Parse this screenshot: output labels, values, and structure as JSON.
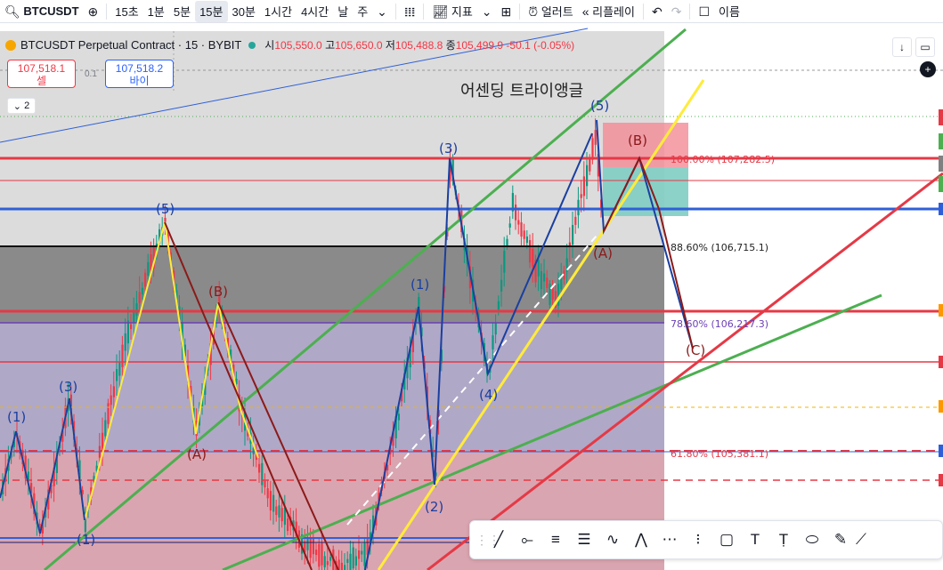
{
  "toolbar": {
    "symbol": "BTCUSDT",
    "intervals": [
      "15초",
      "1분",
      "5분",
      "15분",
      "30분",
      "1시간",
      "4시간",
      "날",
      "주"
    ],
    "active_interval": "15분",
    "indicators": "지표",
    "alert": "얼러트",
    "replay": "리플레이",
    "truncated_right": "이름"
  },
  "legend": {
    "title": "BTCUSDT Perpetual Contract · 15 · BYBIT",
    "open_label": "시",
    "open": "105,550.0",
    "high_label": "고",
    "high": "105,650.0",
    "low_label": "저",
    "low": "105,488.8",
    "close_label": "종",
    "close": "105,499.9",
    "change": "-50.1 (-0.05%)"
  },
  "trade": {
    "sell_price": "107,518.1",
    "sell_label": "셀",
    "spread": "0.1",
    "buy_price": "107,518.2",
    "buy_label": "바이",
    "collapse": "2"
  },
  "annotations": {
    "title": "어센딩 트라이앵글",
    "fib_100": "100.00% (107,282.5)",
    "fib_886": "88.60% (106,715.1)",
    "fib_786": "78.60% (106,217.3)",
    "fib_618": "61.80% (105,381.1)",
    "wave_labels": [
      "(1)",
      "(3)",
      "(5)",
      "(A)",
      "(B)",
      "(1)",
      "(2)",
      "(3)",
      "(4)",
      "(5)",
      "(A)",
      "(B)",
      "(C)",
      "(1)"
    ]
  },
  "colors": {
    "red_line": "#e53946",
    "blue_line": "#2f5fd8",
    "green_line": "#4caf50",
    "yellow_line": "#ffeb3b",
    "teal_box": "#4db6ac",
    "dark_blue_wave": "#1a3fa0",
    "maroon_wave": "#8b1a1a"
  },
  "drawing_tools": [
    "trend-line-icon",
    "horizontal-ray-icon",
    "parallel-channel-icon",
    "fib-icon",
    "elliott-wave-icon",
    "abc-pattern-icon",
    "regression-icon",
    "date-range-icon",
    "rectangle-icon",
    "text-icon",
    "text-anchor-icon",
    "ellipse-icon",
    "brush-icon"
  ]
}
